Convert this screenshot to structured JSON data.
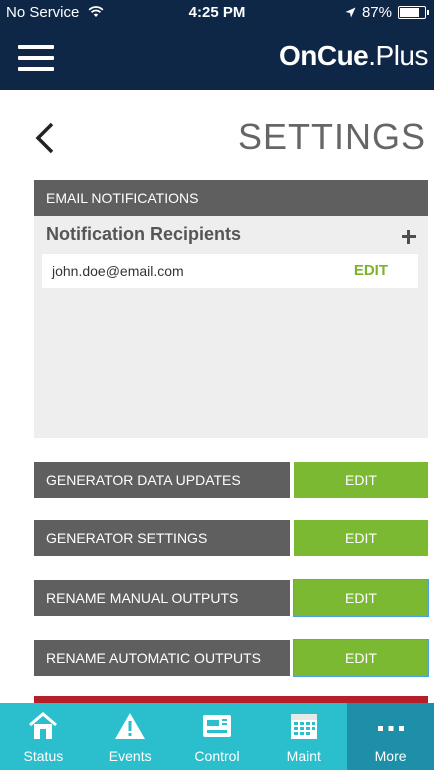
{
  "status_bar": {
    "carrier": "No Service",
    "time": "4:25 PM",
    "battery": "87%",
    "battery_level": 0.87
  },
  "header": {
    "brand_bold": "OnCue",
    "brand_light": ".Plus"
  },
  "page": {
    "title": "SETTINGS"
  },
  "email_section": {
    "header": "EMAIL NOTIFICATIONS",
    "recipients_title": "Notification Recipients",
    "recipients": [
      {
        "email": "john.doe@email.com",
        "edit_label": "EDIT"
      }
    ]
  },
  "settings": [
    {
      "label": "GENERATOR DATA UPDATES",
      "edit_label": "EDIT"
    },
    {
      "label": "GENERATOR SETTINGS",
      "edit_label": "EDIT"
    },
    {
      "label": "RENAME MANUAL OUTPUTS",
      "edit_label": "EDIT"
    },
    {
      "label": "RENAME AUTOMATIC OUTPUTS",
      "edit_label": "EDIT"
    }
  ],
  "tabs": [
    {
      "label": "Status",
      "icon": "house-icon"
    },
    {
      "label": "Events",
      "icon": "warning-icon"
    },
    {
      "label": "Control",
      "icon": "control-panel-icon"
    },
    {
      "label": "Maint",
      "icon": "calendar-icon"
    },
    {
      "label": "More",
      "icon": "more-dots-icon"
    }
  ],
  "colors": {
    "navy": "#0f2747",
    "green": "#7cb932",
    "teal": "#2bbfce",
    "teal_active": "#1e8fa9",
    "gray": "#5f5f5f",
    "red": "#b51f2a"
  }
}
